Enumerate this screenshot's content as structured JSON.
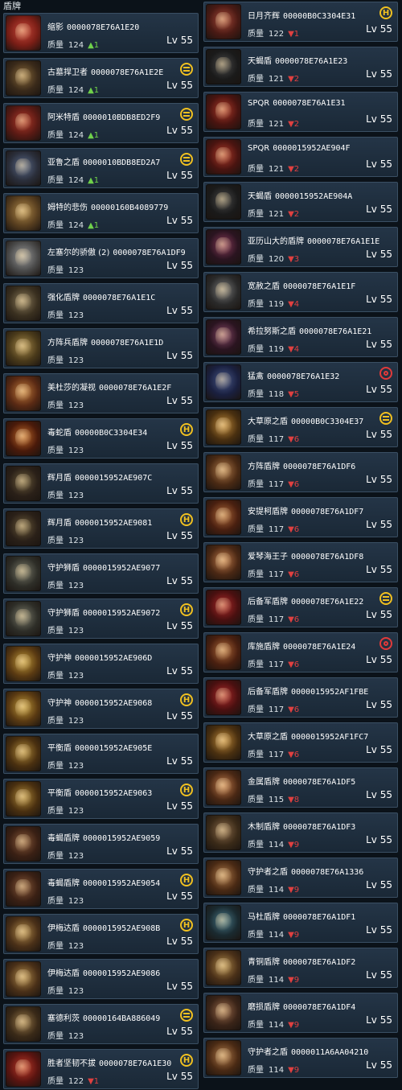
{
  "title": "盾牌",
  "quality_label": "质量",
  "colors": {
    "up": "#6fd14a",
    "down": "#e04040",
    "badge_gold": "#f0c020",
    "badge_red": "#e03a3a"
  },
  "left_items": [
    {
      "name": "缩影",
      "code": "0000078E76A1E20",
      "quality": "124",
      "trend": "up",
      "trend_text": "▲1",
      "lv": "Lv 55",
      "badge": "",
      "icon": "shield-icon",
      "c1": "#c9483a",
      "c2": "#7a1e16"
    },
    {
      "name": "古墓捍卫者",
      "code": "0000078E76A1E2E",
      "quality": "124",
      "trend": "up",
      "trend_text": "▲1",
      "lv": "Lv 55",
      "badge": "crown",
      "icon": "shield-icon",
      "c1": "#8a6a3a",
      "c2": "#3a2a1a"
    },
    {
      "name": "阿米特盾",
      "code": "0000010BDB8ED2F9",
      "quality": "124",
      "trend": "up",
      "trend_text": "▲1",
      "lv": "Lv 55",
      "badge": "crown",
      "icon": "shield-icon",
      "c1": "#b23a2a",
      "c2": "#5a1a14"
    },
    {
      "name": "亚鲁之盾",
      "code": "0000010BDB8ED2A7",
      "quality": "124",
      "trend": "up",
      "trend_text": "▲1",
      "lv": "Lv 55",
      "badge": "crown",
      "icon": "shield-icon",
      "c1": "#5a6a8a",
      "c2": "#2a2e3a"
    },
    {
      "name": "姆特的悲伤",
      "code": "00000160B4089779",
      "quality": "124",
      "trend": "up",
      "trend_text": "▲1",
      "lv": "Lv 55",
      "badge": "",
      "icon": "shield-icon",
      "c1": "#b08a4a",
      "c2": "#5a4020"
    },
    {
      "name": "左塞尔的骄傲 (2)",
      "code": "0000078E76A1DF9",
      "quality": "123",
      "trend": "",
      "trend_text": "",
      "lv": "Lv 55",
      "badge": "",
      "icon": "shield-icon",
      "c1": "#9a9a9a",
      "c2": "#4a4a4a"
    },
    {
      "name": "强化盾牌",
      "code": "0000078E76A1E1C",
      "quality": "123",
      "trend": "",
      "trend_text": "",
      "lv": "Lv 55",
      "badge": "",
      "icon": "shield-icon",
      "c1": "#8a7a5a",
      "c2": "#3a3020"
    },
    {
      "name": "方阵兵盾牌",
      "code": "0000078E76A1E1D",
      "quality": "123",
      "trend": "",
      "trend_text": "",
      "lv": "Lv 55",
      "badge": "",
      "icon": "shield-icon",
      "c1": "#a88a4a",
      "c2": "#4a3a1a"
    },
    {
      "name": "美杜莎的凝视",
      "code": "0000078E76A1E2F",
      "quality": "123",
      "trend": "",
      "trend_text": "",
      "lv": "Lv 55",
      "badge": "",
      "icon": "shield-icon",
      "c1": "#c07a3a",
      "c2": "#5a2a14"
    },
    {
      "name": "毒蛇盾",
      "code": "00000B0C3304E34",
      "quality": "123",
      "trend": "",
      "trend_text": "",
      "lv": "Lv 55",
      "badge": "h",
      "icon": "shield-icon",
      "c1": "#c06a2a",
      "c2": "#4a1a0a"
    },
    {
      "name": "辉月盾",
      "code": "0000015952AE907C",
      "quality": "123",
      "trend": "",
      "trend_text": "",
      "lv": "Lv 55",
      "badge": "",
      "icon": "shield-icon",
      "c1": "#6a5a3a",
      "c2": "#2a2018"
    },
    {
      "name": "辉月盾",
      "code": "0000015952AE9081",
      "quality": "123",
      "trend": "",
      "trend_text": "",
      "lv": "Lv 55",
      "badge": "h",
      "icon": "shield-icon",
      "c1": "#6a5a3a",
      "c2": "#2a2018"
    },
    {
      "name": "守护狮盾",
      "code": "0000015952AE9077",
      "quality": "123",
      "trend": "",
      "trend_text": "",
      "lv": "Lv 55",
      "badge": "",
      "icon": "shield-icon",
      "c1": "#7a7a6a",
      "c2": "#2e2e28"
    },
    {
      "name": "守护狮盾",
      "code": "0000015952AE9072",
      "quality": "123",
      "trend": "",
      "trend_text": "",
      "lv": "Lv 55",
      "badge": "h",
      "icon": "shield-icon",
      "c1": "#7a7a6a",
      "c2": "#2e2e28"
    },
    {
      "name": "守护神",
      "code": "0000015952AE906D",
      "quality": "123",
      "trend": "",
      "trend_text": "",
      "lv": "Lv 55",
      "badge": "",
      "icon": "shield-icon",
      "c1": "#c09a3a",
      "c2": "#5a3a12"
    },
    {
      "name": "守护神",
      "code": "0000015952AE9068",
      "quality": "123",
      "trend": "",
      "trend_text": "",
      "lv": "Lv 55",
      "badge": "h",
      "icon": "shield-icon",
      "c1": "#c09a3a",
      "c2": "#5a3a12"
    },
    {
      "name": "平衡盾",
      "code": "0000015952AE905E",
      "quality": "123",
      "trend": "",
      "trend_text": "",
      "lv": "Lv 55",
      "badge": "",
      "icon": "shield-icon",
      "c1": "#b08a3a",
      "c2": "#4a3010"
    },
    {
      "name": "平衡盾",
      "code": "0000015952AE9063",
      "quality": "123",
      "trend": "",
      "trend_text": "",
      "lv": "Lv 55",
      "badge": "h",
      "icon": "shield-icon",
      "c1": "#b08a3a",
      "c2": "#4a3010"
    },
    {
      "name": "毒蝎盾牌",
      "code": "0000015952AE9059",
      "quality": "123",
      "trend": "",
      "trend_text": "",
      "lv": "Lv 55",
      "badge": "",
      "icon": "shield-icon",
      "c1": "#8a5a3a",
      "c2": "#3a2014"
    },
    {
      "name": "毒蝎盾牌",
      "code": "0000015952AE9054",
      "quality": "123",
      "trend": "",
      "trend_text": "",
      "lv": "Lv 55",
      "badge": "h",
      "icon": "shield-icon",
      "c1": "#8a5a3a",
      "c2": "#3a2014"
    },
    {
      "name": "伊梅达盾",
      "code": "0000015952AE908B",
      "quality": "123",
      "trend": "",
      "trend_text": "",
      "lv": "Lv 55",
      "badge": "h",
      "icon": "shield-icon",
      "c1": "#b08a4a",
      "c2": "#4a3018"
    },
    {
      "name": "伊梅达盾",
      "code": "0000015952AE9086",
      "quality": "123",
      "trend": "",
      "trend_text": "",
      "lv": "Lv 55",
      "badge": "",
      "icon": "shield-icon",
      "c1": "#b08a4a",
      "c2": "#4a3018"
    },
    {
      "name": "塞德利茨",
      "code": "00000164BA886049",
      "quality": "123",
      "trend": "",
      "trend_text": "",
      "lv": "Lv 55",
      "badge": "crown",
      "icon": "shield-icon",
      "c1": "#9a7a4a",
      "c2": "#3a2a18"
    },
    {
      "name": "胜者坚韧不拔",
      "code": "0000078E76A1E30",
      "quality": "122",
      "trend": "down",
      "trend_text": "▼1",
      "lv": "Lv 55",
      "badge": "h",
      "icon": "shield-icon",
      "c1": "#c03a2a",
      "c2": "#5a1410"
    }
  ],
  "right_items": [
    {
      "name": "日月齐辉",
      "code": "00000B0C3304E31",
      "quality": "122",
      "trend": "down",
      "trend_text": "▼1",
      "lv": "Lv 55",
      "badge": "h",
      "icon": "shield-icon",
      "c1": "#a84a3a",
      "c2": "#4a1a14"
    },
    {
      "name": "天蝎盾",
      "code": "0000078E76A1E23",
      "quality": "121",
      "trend": "down",
      "trend_text": "▼2",
      "lv": "Lv 55",
      "badge": "",
      "icon": "shield-icon",
      "c1": "#4a4a4a",
      "c2": "#1a1a1a"
    },
    {
      "name": "SPQR",
      "code": "0000078E76A1E31",
      "quality": "121",
      "trend": "down",
      "trend_text": "▼2",
      "lv": "Lv 55",
      "badge": "",
      "icon": "shield-icon",
      "c1": "#b03a2a",
      "c2": "#4a1410"
    },
    {
      "name": "SPQR",
      "code": "0000015952AE904F",
      "quality": "121",
      "trend": "down",
      "trend_text": "▼2",
      "lv": "Lv 55",
      "badge": "",
      "icon": "shield-icon",
      "c1": "#b03a2a",
      "c2": "#4a1410"
    },
    {
      "name": "天蝎盾",
      "code": "0000015952AE904A",
      "quality": "121",
      "trend": "down",
      "trend_text": "▼2",
      "lv": "Lv 55",
      "badge": "",
      "icon": "shield-icon",
      "c1": "#4a4a4a",
      "c2": "#1a1a1a"
    },
    {
      "name": "亚历山大的盾牌",
      "code": "0000078E76A1E1E",
      "quality": "120",
      "trend": "down",
      "trend_text": "▼3",
      "lv": "Lv 55",
      "badge": "",
      "icon": "shield-icon",
      "c1": "#8a3a5a",
      "c2": "#2a1420"
    },
    {
      "name": "宽赦之盾",
      "code": "0000078E76A1E1F",
      "quality": "119",
      "trend": "down",
      "trend_text": "▼4",
      "lv": "Lv 55",
      "badge": "",
      "icon": "shield-icon",
      "c1": "#7a7a7a",
      "c2": "#2a2a2a"
    },
    {
      "name": "希拉努斯之盾",
      "code": "0000078E76A1E21",
      "quality": "119",
      "trend": "down",
      "trend_text": "▼4",
      "lv": "Lv 55",
      "badge": "",
      "icon": "shield-icon",
      "c1": "#8a4a6a",
      "c2": "#2a1420"
    },
    {
      "name": "猛禽",
      "code": "0000078E76A1E32",
      "quality": "118",
      "trend": "down",
      "trend_text": "▼5",
      "lv": "Lv 55",
      "badge": "s",
      "icon": "shield-icon",
      "c1": "#4a5a8a",
      "c2": "#1a2040"
    },
    {
      "name": "大草原之盾",
      "code": "00000B0C3304E37",
      "quality": "117",
      "trend": "down",
      "trend_text": "▼6",
      "lv": "Lv 55",
      "badge": "crown",
      "icon": "shield-icon",
      "c1": "#c08a3a",
      "c2": "#4a3010"
    },
    {
      "name": "方阵盾牌",
      "code": "0000078E76A1DF6",
      "quality": "117",
      "trend": "down",
      "trend_text": "▼6",
      "lv": "Lv 55",
      "badge": "",
      "icon": "shield-icon",
      "c1": "#b07a4a",
      "c2": "#4a2a14"
    },
    {
      "name": "安提柯盾牌",
      "code": "0000078E76A1DF7",
      "quality": "117",
      "trend": "down",
      "trend_text": "▼6",
      "lv": "Lv 55",
      "badge": "",
      "icon": "shield-icon",
      "c1": "#b06a3a",
      "c2": "#4a2010"
    },
    {
      "name": "爱琴海王子",
      "code": "0000078E76A1DF8",
      "quality": "117",
      "trend": "down",
      "trend_text": "▼6",
      "lv": "Lv 55",
      "badge": "",
      "icon": "shield-icon",
      "c1": "#c07a4a",
      "c2": "#4a2814"
    },
    {
      "name": "后备军盾牌",
      "code": "0000078E76A1E22",
      "quality": "117",
      "trend": "down",
      "trend_text": "▼6",
      "lv": "Lv 55",
      "badge": "crown",
      "icon": "shield-icon",
      "c1": "#b02a2a",
      "c2": "#4a1010"
    },
    {
      "name": "库施盾牌",
      "code": "0000078E76A1E24",
      "quality": "117",
      "trend": "down",
      "trend_text": "▼6",
      "lv": "Lv 55",
      "badge": "s",
      "icon": "shield-icon",
      "c1": "#b06a3a",
      "c2": "#4a2010"
    },
    {
      "name": "后备军盾牌",
      "code": "0000015952AF1FBE",
      "quality": "117",
      "trend": "down",
      "trend_text": "▼6",
      "lv": "Lv 55",
      "badge": "",
      "icon": "shield-icon",
      "c1": "#b02a2a",
      "c2": "#4a1010"
    },
    {
      "name": "大草原之盾",
      "code": "0000015952AF1FC7",
      "quality": "117",
      "trend": "down",
      "trend_text": "▼6",
      "lv": "Lv 55",
      "badge": "",
      "icon": "shield-icon",
      "c1": "#c08a3a",
      "c2": "#4a3010"
    },
    {
      "name": "金属盾牌",
      "code": "0000078E76A1DF5",
      "quality": "115",
      "trend": "down",
      "trend_text": "▼8",
      "lv": "Lv 55",
      "badge": "",
      "icon": "shield-icon",
      "c1": "#c07a4a",
      "c2": "#4a2814"
    },
    {
      "name": "木制盾牌",
      "code": "0000078E76A1DF3",
      "quality": "114",
      "trend": "down",
      "trend_text": "▼9",
      "lv": "Lv 55",
      "badge": "",
      "icon": "shield-icon",
      "c1": "#8a6a4a",
      "c2": "#3a2a18"
    },
    {
      "name": "守护者之盾",
      "code": "0000078E76A1336",
      "quality": "114",
      "trend": "down",
      "trend_text": "▼9",
      "lv": "Lv 55",
      "badge": "",
      "icon": "shield-icon",
      "c1": "#b07a4a",
      "c2": "#4a2a14"
    },
    {
      "name": "马杜盾牌",
      "code": "0000078E76A1DF1",
      "quality": "114",
      "trend": "down",
      "trend_text": "▼9",
      "lv": "Lv 55",
      "badge": "",
      "icon": "shield-icon",
      "c1": "#4a7a8a",
      "c2": "#1a2a30"
    },
    {
      "name": "青铜盾牌",
      "code": "0000078E76A1DF2",
      "quality": "114",
      "trend": "down",
      "trend_text": "▼9",
      "lv": "Lv 55",
      "badge": "",
      "icon": "shield-icon",
      "c1": "#b08a4a",
      "c2": "#4a3018"
    },
    {
      "name": "磨损盾牌",
      "code": "0000078E76A1DF4",
      "quality": "114",
      "trend": "down",
      "trend_text": "▼9",
      "lv": "Lv 55",
      "badge": "",
      "icon": "shield-icon",
      "c1": "#9a6a4a",
      "c2": "#3a2418"
    },
    {
      "name": "守护者之盾",
      "code": "0000011A6AA04210",
      "quality": "114",
      "trend": "down",
      "trend_text": "▼9",
      "lv": "Lv 55",
      "badge": "",
      "icon": "shield-icon",
      "c1": "#b07a4a",
      "c2": "#4a2a14"
    }
  ]
}
